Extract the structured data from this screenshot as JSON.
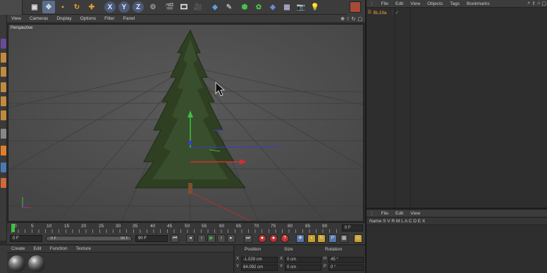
{
  "toolbar": {
    "axis_x": "X",
    "axis_y": "Y",
    "axis_z": "Z"
  },
  "viewport": {
    "menu": [
      "View",
      "Cameras",
      "Display",
      "Options",
      "Filter",
      "Panel"
    ],
    "label": "Perspective"
  },
  "timeline": {
    "ticks": [
      "0",
      "5",
      "10",
      "15",
      "20",
      "25",
      "30",
      "35",
      "40",
      "45",
      "50",
      "55",
      "60",
      "65",
      "70",
      "75",
      "80",
      "85",
      "90"
    ],
    "current_frame": "0 F"
  },
  "transport": {
    "start_field": "0 F",
    "slider_value": "0 F",
    "slider_end": "90 F",
    "end_field": "90 F"
  },
  "material": {
    "menu": [
      "Create",
      "Edit",
      "Function",
      "Texture"
    ]
  },
  "coords": {
    "headers": [
      "Position",
      "Size",
      "Rotation"
    ],
    "rows": [
      {
        "axis": "X",
        "pos": "-1.029 cm",
        "size_axis": "X",
        "size": "0 cm",
        "rot_axis": "H",
        "rot": "45 °"
      },
      {
        "axis": "Y",
        "pos": "64.092 cm",
        "size_axis": "Y",
        "size": "0 cm",
        "rot_axis": "P",
        "rot": "0 °"
      }
    ]
  },
  "objects": {
    "menu": [
      "File",
      "Edit",
      "View",
      "Objects",
      "Tags",
      "Bookmarks"
    ],
    "items": [
      {
        "name": "BL19a"
      }
    ]
  },
  "attributes": {
    "menu": [
      "File",
      "Edit",
      "View"
    ],
    "header": "Name S V R M L A C D E X"
  },
  "colors": {
    "accent": "#5a6e8c",
    "object_name": "#f0b030",
    "playhead": "#3fbf3f"
  }
}
